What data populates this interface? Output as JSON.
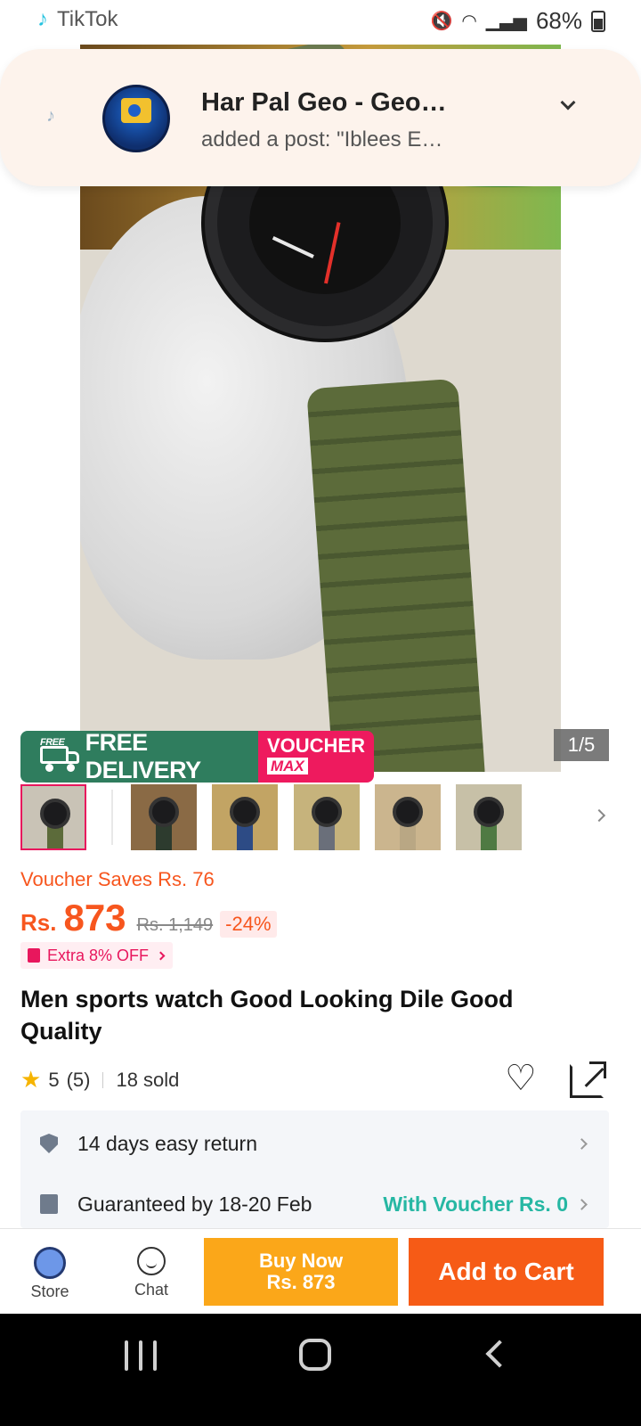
{
  "status_bar": {
    "app_name": "TikTok",
    "battery": "68%",
    "icons": [
      "tiktok-icon",
      "mute-icon",
      "wifi-icon",
      "signal-icon",
      "battery-icon"
    ]
  },
  "notification": {
    "title": "Har Pal Geo - Geo…",
    "subtitle": "added a post: \"Iblees E…"
  },
  "gallery": {
    "counter": "1/5",
    "promo": {
      "free_tag": "FREE",
      "free_delivery": "FREE DELIVERY",
      "voucher": "VOUCHER",
      "max": "MAX"
    },
    "thumbnails_count": 6
  },
  "pricing": {
    "voucher_saves": "Voucher Saves Rs. 76",
    "currency": "Rs.",
    "price": "873",
    "original_price": "Rs. 1,149",
    "discount": "-24%",
    "extra_offer": "Extra 8% OFF"
  },
  "product": {
    "title": "Men sports watch Good Looking Dile Good Quality",
    "rating": "5",
    "rating_count": "(5)",
    "sold": "18 sold"
  },
  "info": {
    "return_policy": "14 days easy return",
    "delivery": "Guaranteed by 18-20 Feb",
    "delivery_voucher": "With Voucher Rs. 0"
  },
  "actions": {
    "store": "Store",
    "chat": "Chat",
    "buy_now_line1": "Buy Now",
    "buy_now_line2": "Rs. 873",
    "add_to_cart": "Add to Cart"
  },
  "colors": {
    "accent_orange": "#f65b16",
    "buy_now": "#fba719",
    "voucher_pink": "#ee1a5e",
    "free_delivery_green": "#2f7d5e",
    "delivery_voucher_teal": "#26b7a3"
  }
}
